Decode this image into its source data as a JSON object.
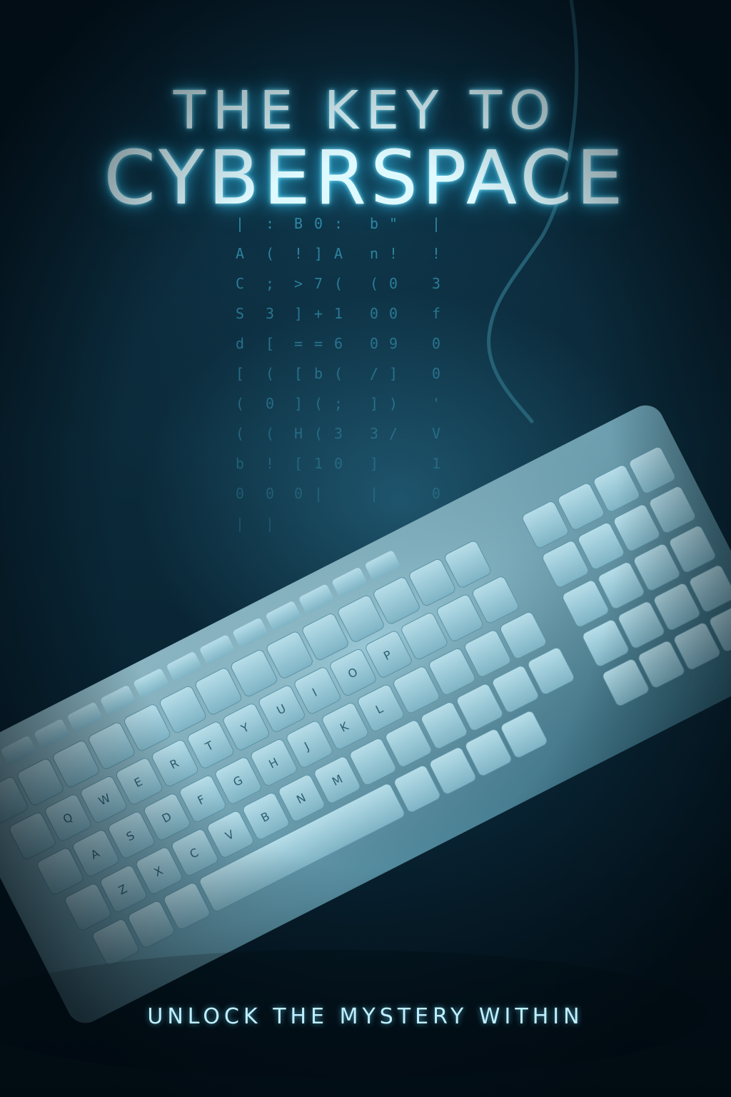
{
  "poster": {
    "title_line1": "THE KEY TO",
    "title_line2": "CYBERSPACE",
    "tagline": "UNLOCK THE MYSTERY WITHIN"
  },
  "colors": {
    "background": "#071c29",
    "glow": "#2fb8e6",
    "title_text": "#dffaff",
    "keyboard_body": "#8fbfcf",
    "key_face": "#a9d3df",
    "code_rain": "#3aa4c4"
  },
  "decor": {
    "code_rain_columns": [
      "| A C S d [ ( ( b 0 |",
      ": ( ; 3 [ ( 0 ( ! 0 |",
      "B ! > ] = [ ] H [ 0",
      "0 ] 7 + = b ( ( 1 |",
      ": A ( 1 6 ( ; 3 0",
      "b n ( 0 0 / ] 3 ] |",
      "\" ! 0 0 9 ] ) /",
      "| ! 3 f 0 0 ' V 1 0"
    ],
    "keyboard_icon": "keyboard-icon",
    "cable_icon": "cable-icon"
  }
}
